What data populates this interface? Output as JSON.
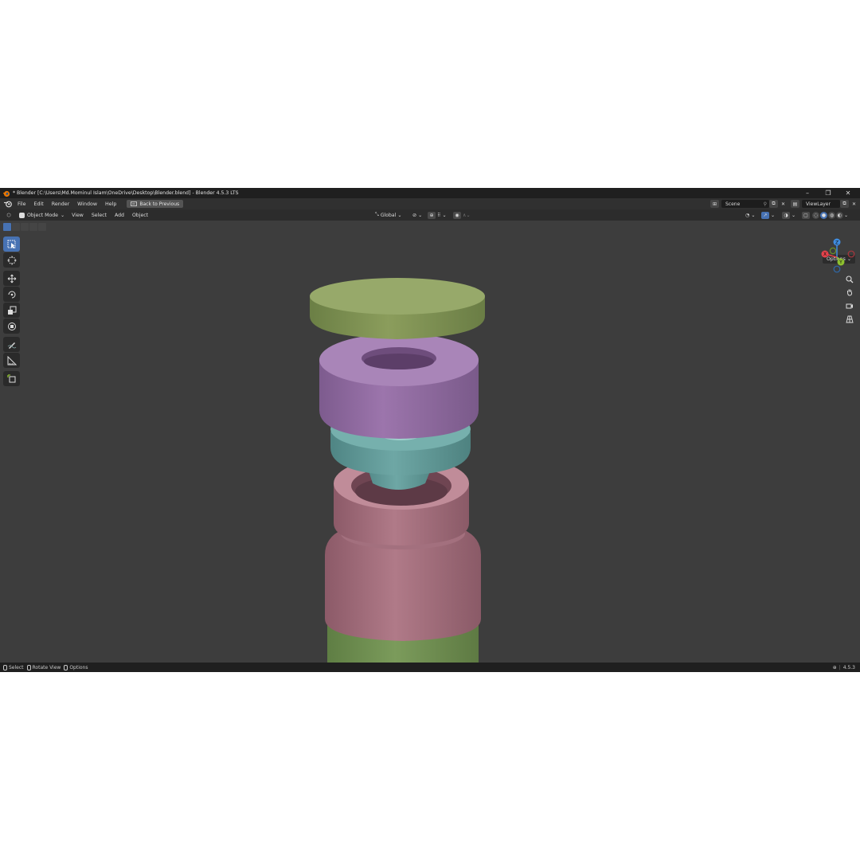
{
  "window": {
    "title": "* Blender [C:\\Users\\Md.Mominul Islam\\OneDrive\\Desktop\\Blender.blend] - Blender 4.5.3 LTS",
    "controls": [
      "–",
      "❐",
      "✕"
    ]
  },
  "topbar": {
    "menus": [
      "File",
      "Edit",
      "Render",
      "Window",
      "Help"
    ],
    "back_button": "Back to Previous",
    "scene": "Scene",
    "view_layer": "ViewLayer"
  },
  "viewport_header": {
    "mode": "Object Mode",
    "menus": [
      "View",
      "Select",
      "Add",
      "Object"
    ],
    "orientation": "Global",
    "options": "Options"
  },
  "toolbar": {
    "tools": [
      "select-box",
      "cursor",
      "move",
      "rotate",
      "scale",
      "transform",
      "annotate",
      "measure",
      "add-cube"
    ],
    "active": "select-box"
  },
  "gizmo": {
    "axes": [
      "X",
      "Y",
      "Z"
    ],
    "colors": {
      "x": "#e5424b",
      "y": "#8ec12f",
      "z": "#3f8de0"
    }
  },
  "scene_objects": [
    {
      "name": "green-lid-disc",
      "color": "#8a9a5b"
    },
    {
      "name": "purple-ring",
      "color": "#9d76ad"
    },
    {
      "name": "teal-stepped-ring",
      "color": "#6aa3a1"
    },
    {
      "name": "pink-collar",
      "color": "#b17a88"
    },
    {
      "name": "pink-body-cap",
      "color": "#b27b88"
    },
    {
      "name": "green-cylinder-body",
      "color": "#7a9a5a"
    }
  ],
  "statusbar": {
    "items": [
      "Select",
      "Rotate View",
      "Options"
    ],
    "version": "4.5.3"
  },
  "colors": {
    "accent": "#4772b3",
    "viewport_bg": "#3d3d3d",
    "header_bg": "#2c2c2c"
  }
}
